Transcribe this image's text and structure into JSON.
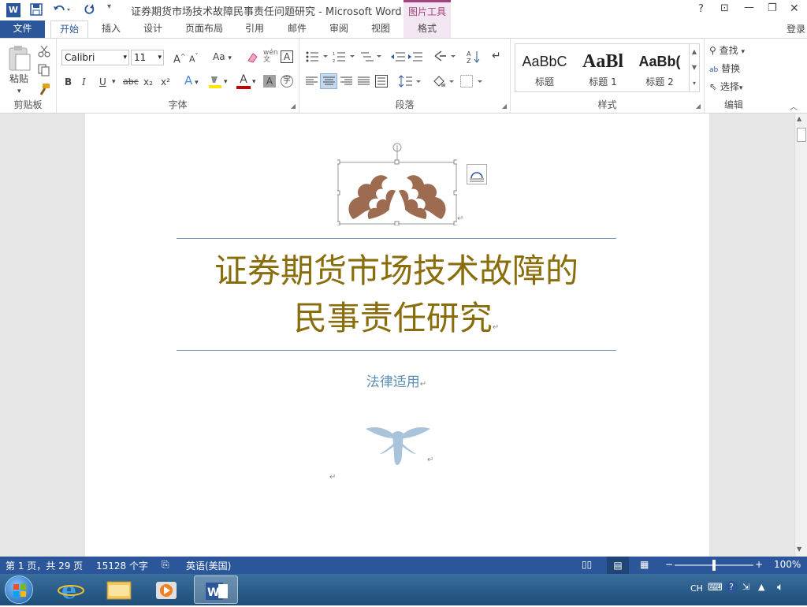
{
  "window": {
    "title": "证券期货市场技术故障民事责任问题研究 - Microsoft Word",
    "context_tool": "图片工具",
    "controls": {
      "help": "?",
      "restore_ribbon": "⊡",
      "minimize": "—",
      "maximize": "❐",
      "close": "✕"
    },
    "quick_access": {
      "save": "save-icon",
      "undo": "undo-icon",
      "redo": "redo-icon"
    }
  },
  "tabs": [
    "文件",
    "开始",
    "插入",
    "设计",
    "页面布局",
    "引用",
    "邮件",
    "审阅",
    "视图",
    "格式"
  ],
  "active_tab": "开始",
  "sign_in": "登录",
  "ribbon": {
    "clipboard": {
      "label": "剪贴板",
      "paste": "粘贴"
    },
    "font": {
      "label": "字体",
      "name": "Calibri",
      "size": "11",
      "case": "Aa",
      "bold": "B",
      "italic": "I",
      "underline": "U",
      "strike": "abc",
      "sub": "x₂",
      "sup": "x²",
      "grow": "A",
      "shrink": "A"
    },
    "paragraph": {
      "label": "段落"
    },
    "styles": {
      "label": "样式",
      "items": [
        {
          "sample": "AaBbC",
          "name": "标题"
        },
        {
          "sample": "AaBl",
          "name": "标题 1"
        },
        {
          "sample": "AaBb(",
          "name": "标题 2"
        }
      ]
    },
    "editing": {
      "label": "编辑",
      "find": "查找",
      "replace": "替换",
      "select": "选择"
    }
  },
  "document": {
    "title_line1": "证券期货市场技术故障的",
    "title_line2": "民事责任研究",
    "subtitle": "法律适用",
    "para_mark": "↵"
  },
  "status": {
    "page": "第 1 页，共 29 页",
    "words": "15128 个字",
    "language": "英语(美国)",
    "zoom": "100%",
    "zoom_level_percent": 100
  },
  "taskbar": {
    "ime": "CH"
  },
  "colors": {
    "accent": "#2b579a",
    "title": "#8a6d0b",
    "subtitle": "#5b8fb5",
    "ornament": "#9c6b50",
    "context": "#a5407e"
  }
}
